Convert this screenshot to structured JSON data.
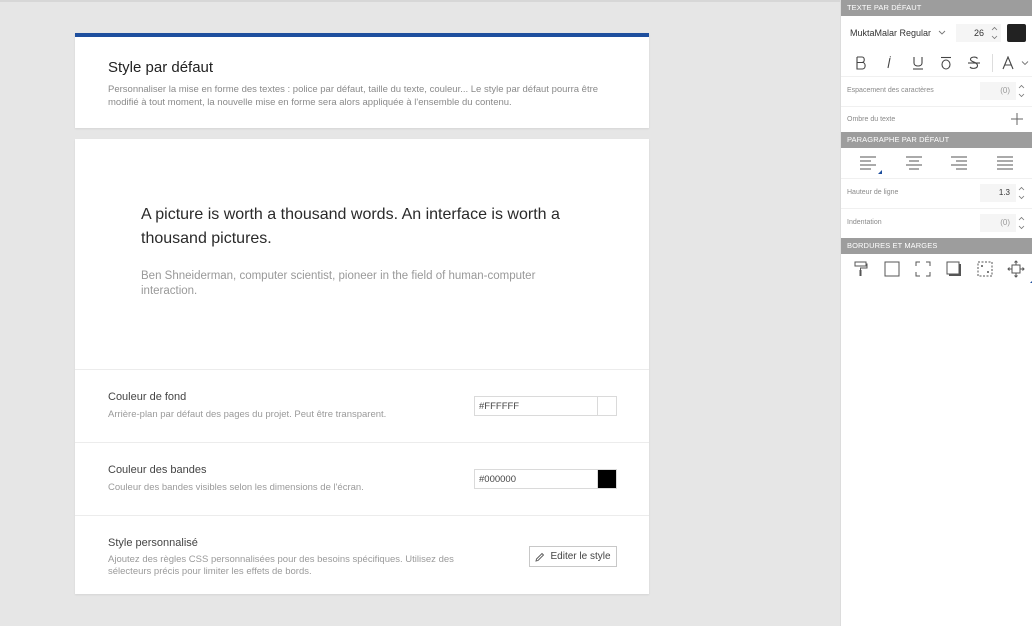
{
  "header": {
    "title": "Style par défaut",
    "description": "Personnaliser la mise en forme des textes : police par défaut, taille du texte, couleur... Le style par défaut pourra être modifié à tout moment, la nouvelle mise en forme sera alors appliquée à l'ensemble du contenu."
  },
  "preview": {
    "quote": "A picture is worth a thousand words. An interface is worth a thousand pictures.",
    "author": "Ben Shneiderman, computer scientist, pioneer in the field of human-computer interaction."
  },
  "settings": {
    "background": {
      "label": "Couleur de fond",
      "description": "Arrière-plan par défaut des pages du projet. Peut être transparent.",
      "value": "#FFFFFF",
      "swatch": "#FFFFFF"
    },
    "bands": {
      "label": "Couleur des bandes",
      "description": "Couleur des bandes visibles selon les dimensions de l'écran.",
      "value": "#000000",
      "swatch": "#000000"
    },
    "custom_style": {
      "label": "Style personnalisé",
      "description": "Ajoutez des règles CSS personnalisées pour des besoins spécifiques. Utilisez des sélecteurs précis pour limiter les effets de bords.",
      "button_label": "Editer le style"
    }
  },
  "panel": {
    "text_section": {
      "title": "TEXTE PAR DÉFAUT",
      "font_family": "MuktaMalar Regular",
      "font_size": "26",
      "font_color": "#222222",
      "style_buttons": [
        "B",
        "I",
        "U",
        "Ō",
        "S",
        "A"
      ],
      "letter_spacing_label": "Espacement des caractères",
      "letter_spacing_value": "(0)",
      "shadow_label": "Ombre du texte"
    },
    "paragraph_section": {
      "title": "PARAGRAPHE PAR DÉFAUT",
      "line_height_label": "Hauteur de ligne",
      "line_height_value": "1.3",
      "indent_label": "Indentation",
      "indent_value": "(0)"
    },
    "borders_section": {
      "title": "BORDURES ET MARGES"
    }
  },
  "colors": {
    "accent": "#1e4f9e",
    "section_header": "#9d9d9d",
    "background": "#e6e6e6"
  }
}
